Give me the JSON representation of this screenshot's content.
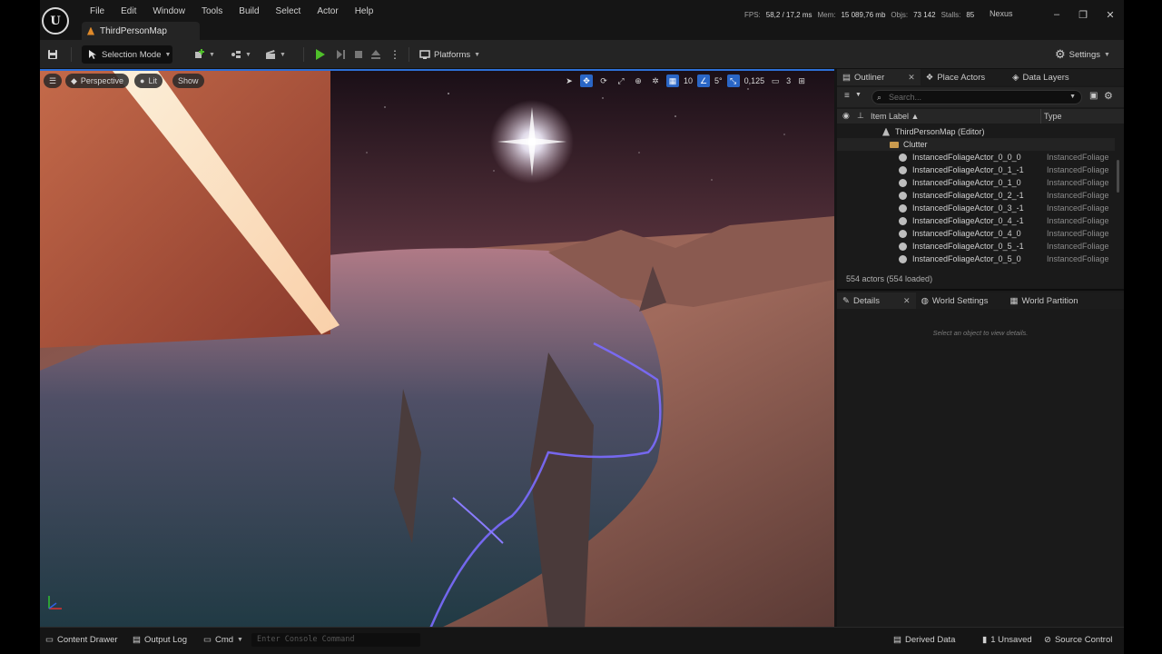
{
  "titlebar": {
    "logo_text": "U",
    "menu": [
      "File",
      "Edit",
      "Window",
      "Tools",
      "Build",
      "Select",
      "Actor",
      "Help"
    ],
    "map_tab": "ThirdPersonMap",
    "stats": {
      "fps_label": "FPS:",
      "fps_value": "58,2 / 17,2 ms",
      "mem_label": "Mem:",
      "mem_value": "15 089,76 mb",
      "objs_label": "Objs:",
      "objs_value": "73 142",
      "stalls_label": "Stalls:",
      "stalls_value": "85"
    },
    "project": "Nexus",
    "window_controls": [
      "–",
      "❐",
      "✕"
    ]
  },
  "toolbar": {
    "selection_mode": "Selection Mode",
    "platforms": "Platforms",
    "settings": "Settings",
    "play_color": "#4fbf2a"
  },
  "viewport": {
    "perspective": "Perspective",
    "lit": "Lit",
    "show": "Show",
    "grid_size": "10",
    "rotation_snap": "5°",
    "camera_speed": "0,125",
    "camera_count": "3",
    "accent": "#2a66c6"
  },
  "outliner": {
    "tabs": {
      "outliner": "Outliner",
      "place_actors": "Place Actors",
      "data_layers": "Data Layers"
    },
    "search_placeholder": "Search...",
    "col_label": "Item Label",
    "col_type": "Type",
    "root": "ThirdPersonMap (Editor)",
    "folder": "Clutter",
    "rows": [
      {
        "name": "InstancedFoliageActor_0_0_0",
        "type": "InstancedFoliage"
      },
      {
        "name": "InstancedFoliageActor_0_1_-1",
        "type": "InstancedFoliage"
      },
      {
        "name": "InstancedFoliageActor_0_1_0",
        "type": "InstancedFoliage"
      },
      {
        "name": "InstancedFoliageActor_0_2_-1",
        "type": "InstancedFoliage"
      },
      {
        "name": "InstancedFoliageActor_0_3_-1",
        "type": "InstancedFoliage"
      },
      {
        "name": "InstancedFoliageActor_0_4_-1",
        "type": "InstancedFoliage"
      },
      {
        "name": "InstancedFoliageActor_0_4_0",
        "type": "InstancedFoliage"
      },
      {
        "name": "InstancedFoliageActor_0_5_-1",
        "type": "InstancedFoliage"
      },
      {
        "name": "InstancedFoliageActor_0_5_0",
        "type": "InstancedFoliage"
      }
    ],
    "actor_count": "554 actors (554 loaded)"
  },
  "details": {
    "tabs": {
      "details": "Details",
      "world_settings": "World Settings",
      "world_partition": "World Partition"
    },
    "empty_message": "Select an object to view details."
  },
  "statusbar": {
    "content_drawer": "Content Drawer",
    "output_log": "Output Log",
    "cmd": "Cmd",
    "console_placeholder": "Enter Console Command",
    "derived_data": "Derived Data",
    "unsaved": "1 Unsaved",
    "source_control": "Source Control"
  }
}
